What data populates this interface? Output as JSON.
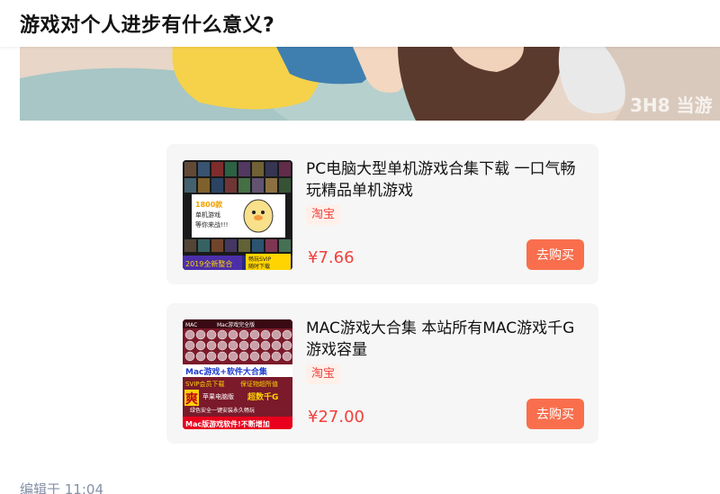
{
  "question": {
    "title": "游戏对个人进步有什么意义?"
  },
  "products": [
    {
      "title": "PC电脑大型单机游戏合集下载 一口气畅玩精品单机游戏",
      "shop": "淘宝",
      "price": "¥7.66",
      "buy_label": "去购买",
      "thumb": {
        "badge_top": "1800款\n单机游戏\n等你来战!!",
        "footer_left": "2019全新整合",
        "footer_right": "畅玩SVIP\n随时下载"
      }
    },
    {
      "title": "MAC游戏大合集 本站所有MAC游戏千G游戏容量",
      "shop": "淘宝",
      "price": "¥27.00",
      "buy_label": "去购买",
      "thumb": {
        "top_left": "MAC",
        "top_center": "Mac游戏完全版",
        "banner": "Mac游戏+软件大合集",
        "line1": "SVIP会员下载",
        "line1b": "保证物超所值",
        "big_char": "爽",
        "line2": "苹果电脑版",
        "line2b": "超数千G",
        "line3": "绿色安全一键安装永久畅玩",
        "line4": "Mac版游戏软件!不断增加"
      }
    }
  ],
  "footer": {
    "edited": "编辑于 11:04"
  },
  "colors": {
    "accent": "#f1403c",
    "buy_button": "#f96f4e",
    "card_bg": "#f6f6f6",
    "muted": "#8590a6"
  }
}
